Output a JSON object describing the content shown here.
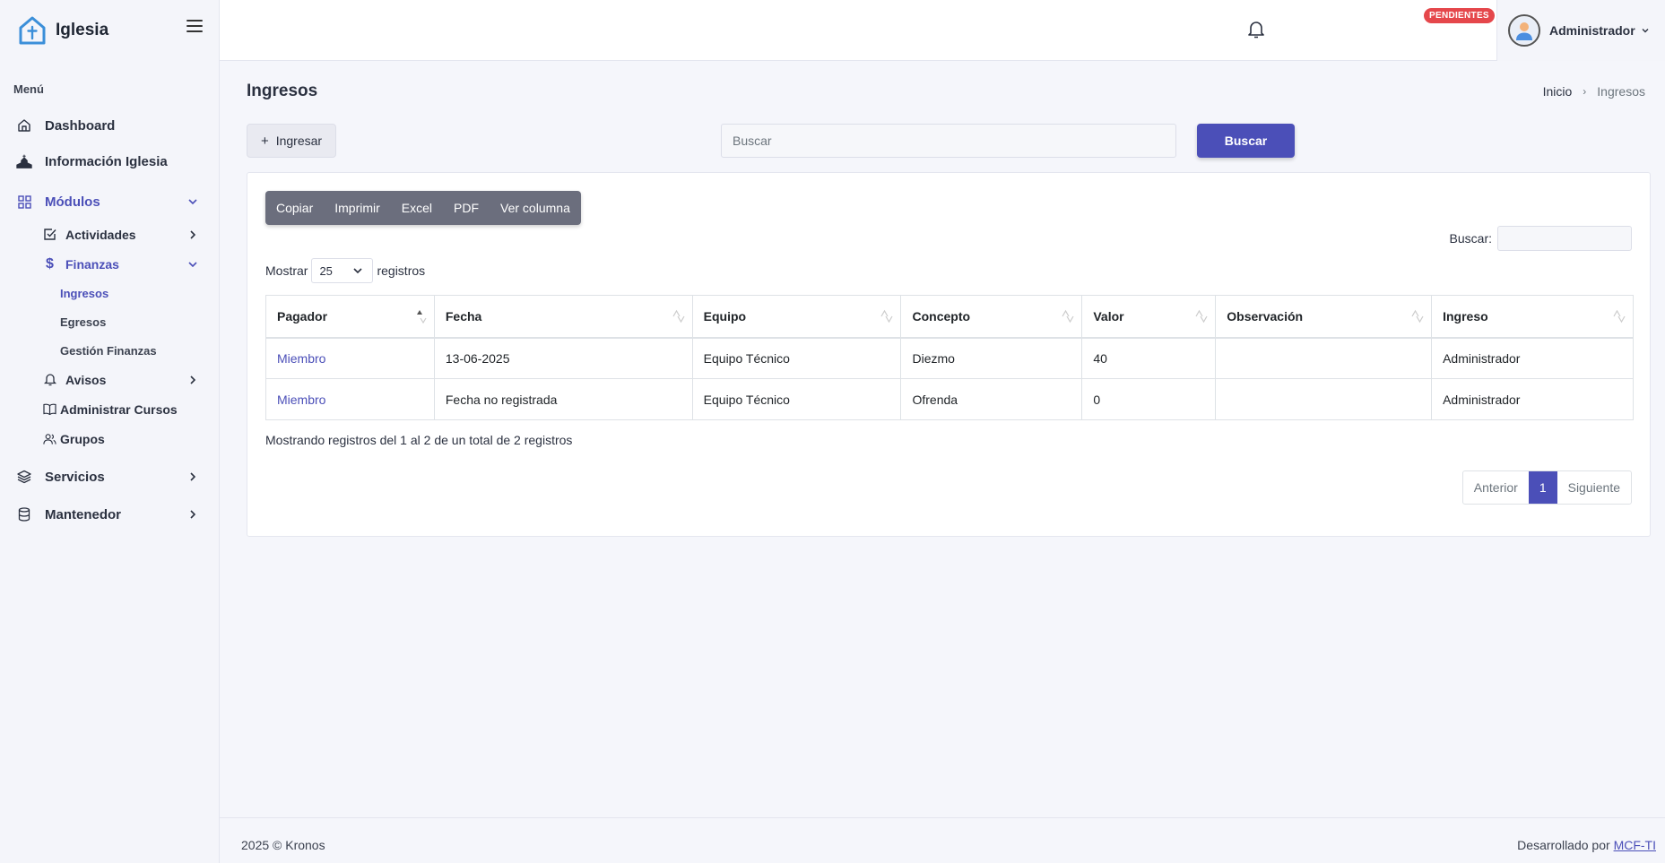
{
  "brand": {
    "name": "Iglesia"
  },
  "sidebar": {
    "menu_title": "Menú",
    "dashboard": "Dashboard",
    "informacion": "Información Iglesia",
    "modulos": "Módulos",
    "actividades": "Actividades",
    "finanzas": "Finanzas",
    "ingresos": "Ingresos",
    "egresos": "Egresos",
    "gestion_finanzas": "Gestión Finanzas",
    "avisos": "Avisos",
    "administrar_cursos": "Administrar Cursos",
    "grupos": "Grupos",
    "servicios": "Servicios",
    "mantenedor": "Mantenedor"
  },
  "topbar": {
    "badge": "PENDIENTES",
    "user_name": "Administrador"
  },
  "page": {
    "title": "Ingresos",
    "breadcrumb_home": "Inicio",
    "breadcrumb_current": "Ingresos",
    "add_button": "Ingresar",
    "search_placeholder": "Buscar",
    "search_button": "Buscar"
  },
  "datatable": {
    "buttons": [
      "Copiar",
      "Imprimir",
      "Excel",
      "PDF",
      "Ver columna"
    ],
    "search_label": "Buscar:",
    "length_prefix": "Mostrar",
    "length_value": "25",
    "length_suffix": "registros",
    "columns": [
      "Pagador",
      "Fecha",
      "Equipo",
      "Concepto",
      "Valor",
      "Observación",
      "Ingreso"
    ],
    "rows": [
      [
        "Miembro",
        "13-06-2025",
        "Equipo Técnico",
        "Diezmo",
        "40",
        "",
        "Administrador"
      ],
      [
        "Miembro",
        "Fecha no registrada",
        "Equipo Técnico",
        "Ofrenda",
        "0",
        "",
        "Administrador"
      ]
    ],
    "info": "Mostrando registros del 1 al 2 de un total de 2 registros",
    "pager_prev": "Anterior",
    "pager_current": "1",
    "pager_next": "Siguiente"
  },
  "footer": {
    "left": "2025 © Kronos",
    "right_prefix": "Desarrollado por",
    "right_link": "MCF-TI"
  },
  "colors": {
    "accent": "#4b4fb8",
    "badge": "#e5474b",
    "brand_logo": "#3b8fd9"
  }
}
